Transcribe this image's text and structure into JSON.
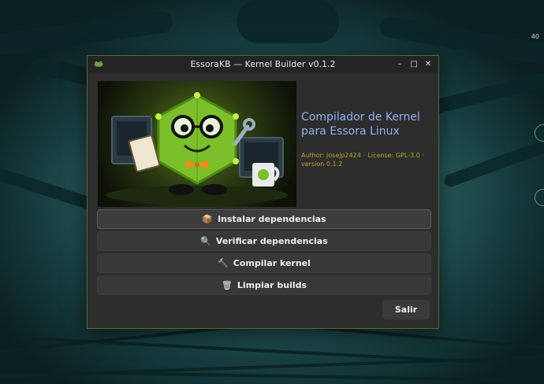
{
  "window": {
    "title": "EssoraKB — Kernel Builder v0.1.2",
    "controls": {
      "minimize": "–",
      "maximize": "□",
      "close": "✕"
    }
  },
  "app": {
    "heading": "Compilador de Kernel para Essora Linux",
    "author": "Author: josejp2424",
    "license": "License: GPL-3.0",
    "version": "version 0.1.2",
    "separator": "·"
  },
  "actions": [
    {
      "icon": "📦",
      "icon_name": "package-icon",
      "label": "Instalar dependencias"
    },
    {
      "icon": "🔍",
      "icon_name": "magnifier-icon",
      "label": "Verificar dependencias"
    },
    {
      "icon": "🔨",
      "icon_name": "hammer-icon",
      "label": "Compilar kernel"
    },
    {
      "icon": "🗑",
      "icon_name": "trash-icon",
      "label": "Limpiar builds"
    }
  ],
  "exit_label": "Salir",
  "desktop": {
    "indicator": "40"
  },
  "colors": {
    "accent_heading": "#8fb4ea",
    "meta_text": "#b5a42a",
    "window_border": "#556b2f",
    "window_bg": "#2d2d2d"
  }
}
